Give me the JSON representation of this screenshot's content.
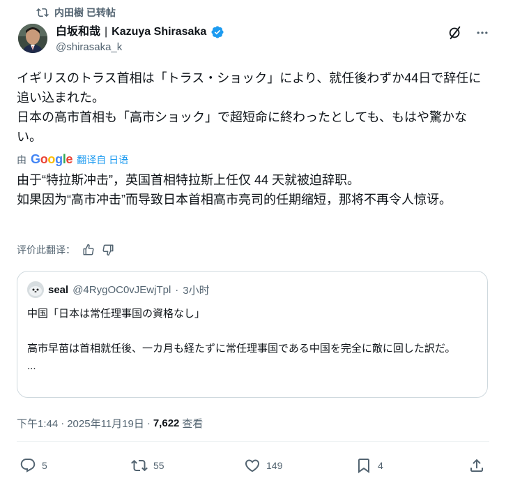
{
  "retweet": {
    "text": "内田樹 已转帖"
  },
  "author": {
    "name": "白坂和哉",
    "name_en": "Kazuya Shirasaka",
    "separator": "|",
    "handle": "@shirasaka_k",
    "verified_color": "#1d9bf0"
  },
  "tweet": {
    "lines": [
      "イギリスのトラス首相は「トラス・ショック」により、就任後わずか44日で辞任に追い込まれた。",
      "日本の高市首相も「高市ショック」で超短命に終わったとしても、もはや驚かない。"
    ]
  },
  "translation": {
    "by_label": "由",
    "provider": "Google",
    "link_label": "翻译自 日语",
    "lines": [
      "由于“特拉斯冲击”，英国首相特拉斯上任仅 44 天就被迫辞职。",
      "如果因为“高市冲击”而导致日本首相高市亮司的任期缩短，那将不再令人惊讶。"
    ],
    "rate_label": "评价此翻译："
  },
  "quote": {
    "name": "seal",
    "handle": "@4RygOC0vJEwjTpl",
    "dot": "·",
    "time": "3小时",
    "lines": [
      "中国「日本は常任理事国の資格なし」",
      "",
      "高市早苗は首相就任後、一カ月も経たずに常任理事国である中国を完全に敵に回した訳だ。",
      "..."
    ]
  },
  "meta": {
    "time": "下午1:44",
    "dot": "·",
    "date": "2025年11月19日",
    "dot2": "·",
    "views": "7,622",
    "views_label": "查看"
  },
  "actions": {
    "reply_count": "5",
    "retweet_count": "55",
    "like_count": "149",
    "bookmark_count": "4"
  },
  "colors": {
    "accent": "#1d9bf0",
    "muted": "#536471",
    "text": "#0f1419",
    "border": "#cfd9de"
  },
  "icons": [
    "retweet-icon",
    "verified-badge-icon",
    "grok-icon",
    "more-icon",
    "thumbs-up-icon",
    "thumbs-down-icon",
    "reply-icon",
    "like-icon",
    "bookmark-icon",
    "share-icon"
  ]
}
